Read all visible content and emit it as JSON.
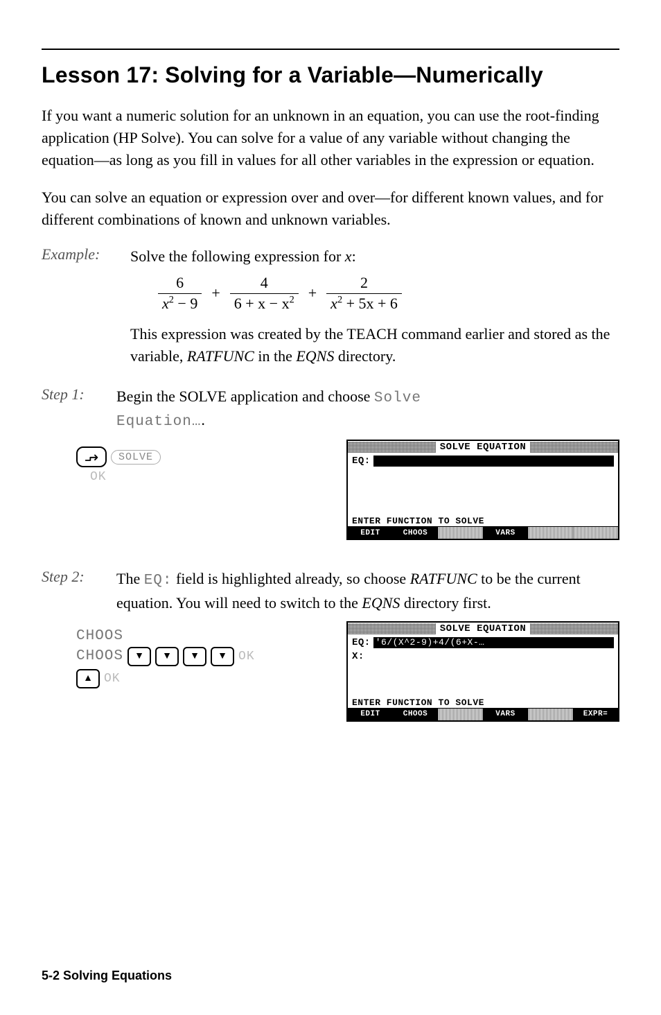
{
  "lesson_title": "Lesson 17: Solving for a Variable—Numerically",
  "para1": "If you want a numeric solution for an unknown in an equation, you can use the root-finding application (HP Solve). You can solve for a value of any variable without changing the equation—as long as you fill in values for all other variables in the expression or equation.",
  "para2": "You can solve an equation or expression over and over—for different known values, and for different combinations of known and unknown variables.",
  "example_label": "Example:",
  "example_intro_a": "Solve the following expression for ",
  "example_var": "x",
  "example_intro_b": ":",
  "math": {
    "f1_num": "6",
    "f1_den_a": "x",
    "f1_den_b": " − 9",
    "plus": "+",
    "f2_num": "4",
    "f2_den_a": "6 + x − x",
    "f3_num": "2",
    "f3_den_a": "x",
    "f3_den_b": " + 5x + 6"
  },
  "example_after": "This expression was created by the TEACH command earlier and stored as the variable, ",
  "ratfunc": "RATFUNC",
  "example_after_b": " in the ",
  "eqns": "EQNS",
  "example_after_c": " directory.",
  "step1_label": "Step 1:",
  "step1_text_a": "Begin the SOLVE application and choose ",
  "step1_lcd_a": "Solve",
  "step1_lcd_b": "Equation…",
  "step1_text_c": ".",
  "step1_keys": {
    "solve_label": "SOLVE",
    "ok_label": "OK"
  },
  "screen1": {
    "title": "SOLVE EQUATION",
    "eq_label": "EQ:",
    "eq_value": "",
    "prompt": "ENTER FUNCTION TO SOLVE",
    "menu": [
      "EDIT",
      "CHOOS",
      "",
      "VARS",
      "",
      ""
    ]
  },
  "step2_label": "Step 2:",
  "step2_text_a": "The ",
  "step2_lcd": "EQ:",
  "step2_text_b": " field is highlighted already, so choose ",
  "step2_ital": "RATFUNC",
  "step2_text_c": " to be the current equation. You will need to switch to the ",
  "step2_ital2": "EQNS",
  "step2_text_d": " directory first.",
  "step2_keys": {
    "choos": "CHOOS",
    "ok": "OK"
  },
  "screen2": {
    "title": "SOLVE EQUATION",
    "eq_label": "EQ:",
    "eq_value": "'6/(X^2-9)+4/(6+X-…",
    "x_label": "X:",
    "prompt": "ENTER FUNCTION TO SOLVE",
    "menu": [
      "EDIT",
      "CHOOS",
      "",
      "VARS",
      "",
      "EXPR="
    ]
  },
  "footer": "5-2   Solving Equations"
}
